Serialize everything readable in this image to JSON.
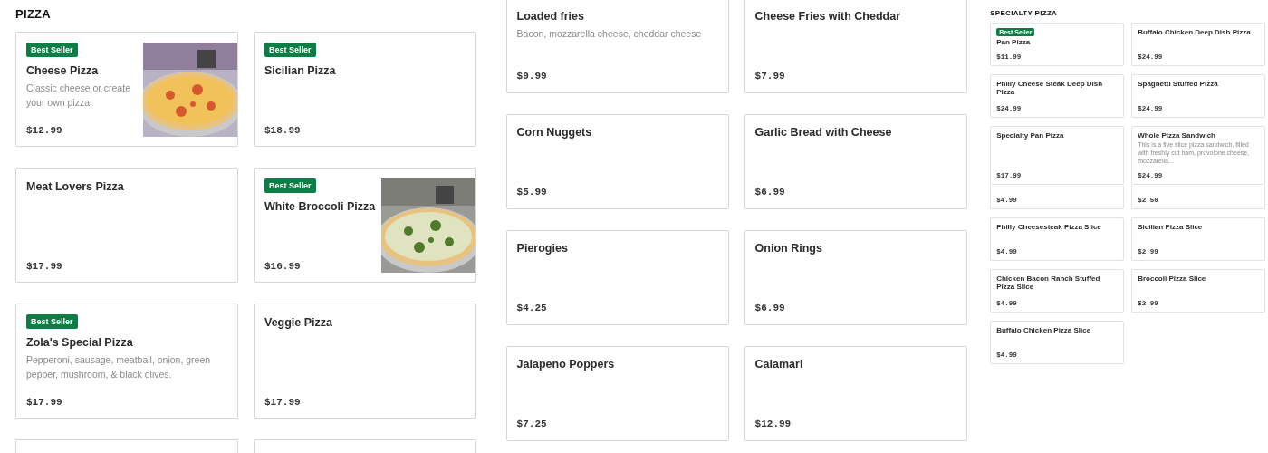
{
  "panels": [
    {
      "heading": "PIZZA",
      "cards": [
        {
          "badge": "Best Seller",
          "name": "Cheese Pizza",
          "description": "Classic cheese or create your own pizza.",
          "price": "$12.99"
        },
        {
          "badge": "Best Seller",
          "name": "Sicilian Pizza",
          "price": "$18.99"
        },
        {
          "name": "Meat Lovers Pizza",
          "price": "$17.99"
        },
        {
          "badge": "Best Seller",
          "name": "White Broccoli Pizza",
          "price": "$16.99"
        },
        {
          "badge": "Best Seller",
          "name": "Zola's Special Pizza",
          "description": "Pepperoni, sausage, meatball, onion, green pepper, mushroom, & black olives.",
          "price": "$17.99"
        },
        {
          "name": "Veggie Pizza",
          "price": "$17.99"
        }
      ]
    },
    {
      "cards": [
        {
          "name": "Loaded fries",
          "description": "Bacon, mozzarella cheese, cheddar cheese",
          "price": "$9.99"
        },
        {
          "name": "Cheese Fries with Cheddar",
          "price": "$7.99"
        },
        {
          "name": "Corn Nuggets",
          "price": "$5.99"
        },
        {
          "name": "Garlic Bread with Cheese",
          "price": "$6.99"
        },
        {
          "name": "Pierogies",
          "price": "$4.25"
        },
        {
          "name": "Onion Rings",
          "price": "$6.99"
        },
        {
          "name": "Jalapeno Poppers",
          "price": "$7.25"
        },
        {
          "name": "Calamari",
          "price": "$12.99"
        }
      ]
    },
    {
      "heading": "SPECIALTY PIZZA",
      "cards": [
        {
          "kind": "full",
          "badge": "Best Seller",
          "name": "Pan Pizza",
          "price": "$11.99"
        },
        {
          "kind": "full",
          "name": "Buffalo Chicken Deep Dish Pizza",
          "price": "$24.99"
        },
        {
          "kind": "full",
          "name": "Philly Cheese Steak Deep Dish Pizza",
          "price": "$24.99"
        },
        {
          "kind": "full",
          "name": "Spaghetti Stuffed Pizza",
          "price": "$24.99"
        },
        {
          "kind": "full",
          "name": "Specialty Pan Pizza",
          "price": "$17.99"
        },
        {
          "kind": "full",
          "name": "Whole Pizza Sandwich",
          "description": "This is a five slice pizza sandwich, filled with freshly cut ham, provolone cheese, mozzarella...",
          "price": "$24.99"
        },
        {
          "kind": "fragment",
          "price": "$4.99"
        },
        {
          "kind": "fragment",
          "price": "$2.50"
        },
        {
          "kind": "full",
          "name": "Philly Cheesesteak Pizza Slice",
          "price": "$4.99"
        },
        {
          "kind": "full",
          "name": "Sicilian Pizza Slice",
          "price": "$2.99"
        },
        {
          "kind": "full",
          "name": "Chicken Bacon Ranch Stuffed Pizza Slice",
          "price": "$4.99"
        },
        {
          "kind": "full",
          "name": "Broccoli Pizza Slice",
          "price": "$2.99"
        },
        {
          "kind": "full",
          "name": "Buffalo Chicken Pizza Slice",
          "price": "$4.99"
        }
      ]
    }
  ]
}
